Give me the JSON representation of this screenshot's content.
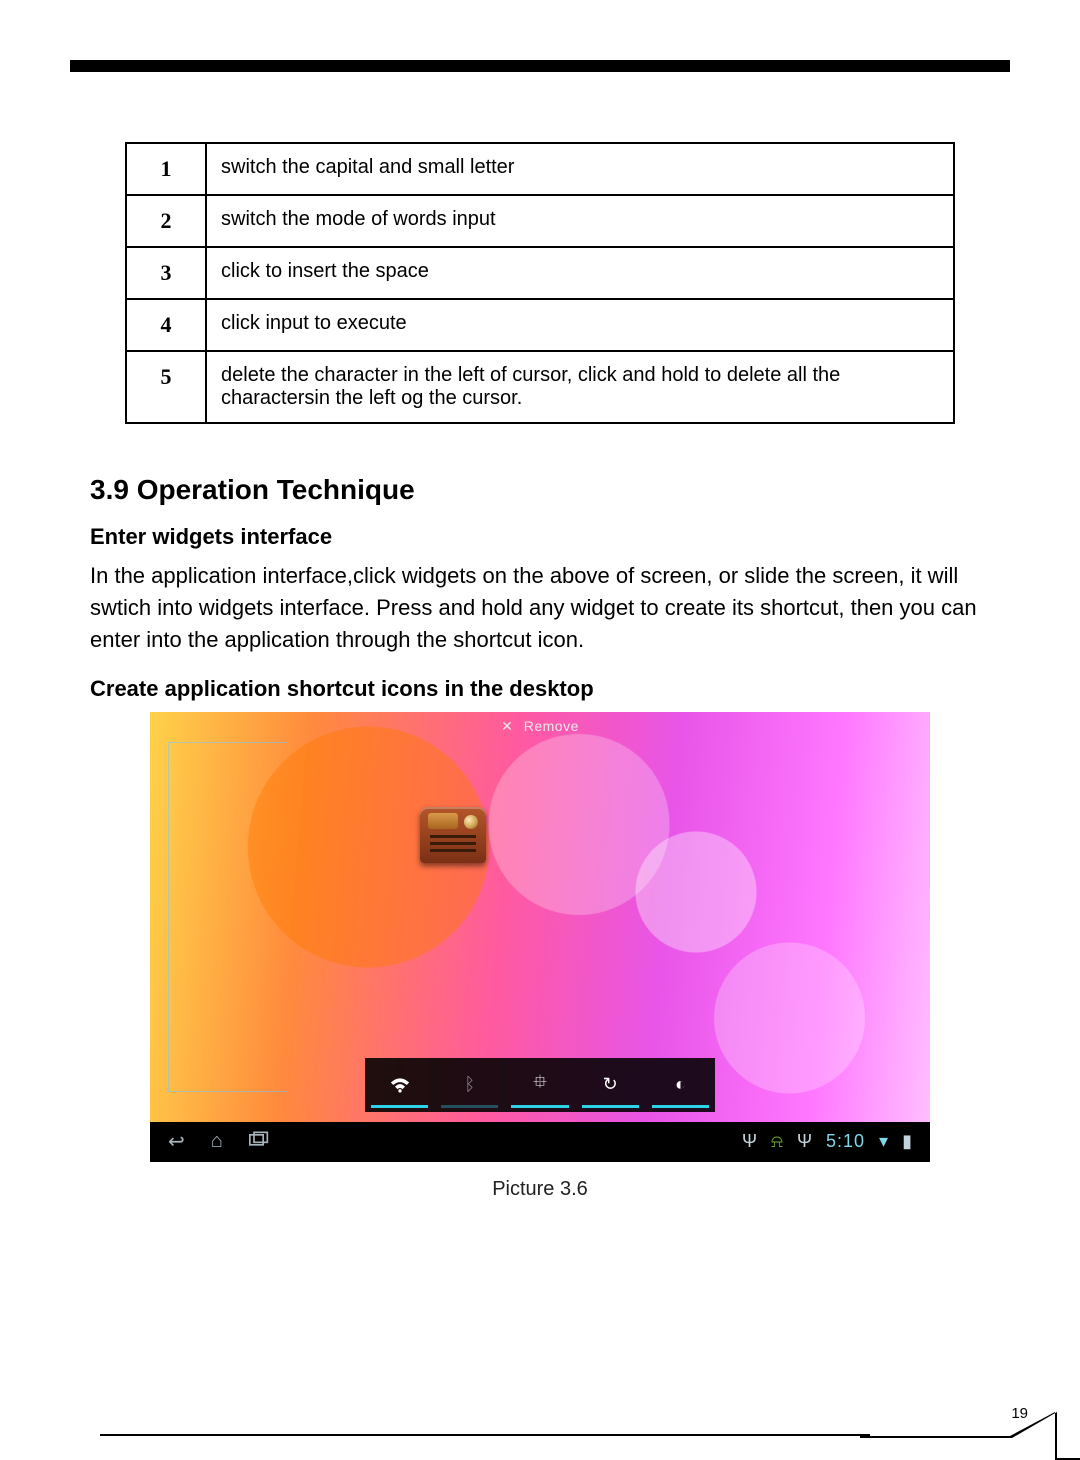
{
  "table": {
    "rows": [
      {
        "num": "1",
        "desc": "switch the capital and small letter"
      },
      {
        "num": "2",
        "desc": "switch the mode of words input"
      },
      {
        "num": "3",
        "desc": "click  to insert the space"
      },
      {
        "num": "4",
        "desc": "click  input to execute"
      },
      {
        "num": "5",
        "desc": "delete the character in the left of cursor, click and hold to delete all the charactersin the left og the cursor."
      }
    ]
  },
  "section_heading": "3.9 Operation Technique",
  "subhead1": "Enter widgets interface",
  "para1": "In the application interface,click widgets on the above of screen, or slide the screen, it will swtich into widgets interface. Press and hold any widget to create its shortcut, then you can enter into the application through the shortcut icon.",
  "subhead2": "Create application shortcut icons in the desktop",
  "screenshot": {
    "remove_label": "Remove",
    "sysbar_time": "5:10",
    "quick_icons": [
      "wifi",
      "bluetooth",
      "gps",
      "sync",
      "brightness"
    ],
    "nav_icons": [
      "back",
      "home",
      "recent"
    ],
    "status_icons": [
      "usb",
      "android-debug",
      "usb",
      "time",
      "wifi",
      "battery"
    ]
  },
  "caption": "Picture 3.6",
  "page_number": "19"
}
